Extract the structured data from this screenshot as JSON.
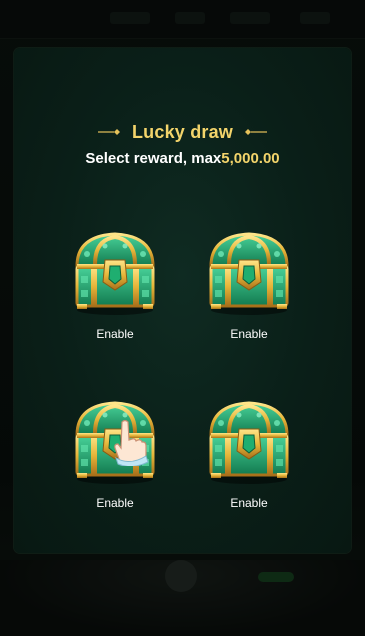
{
  "dialog": {
    "title": "Lucky draw",
    "subtitle_prefix": "Select reward, max",
    "max_amount": "5,000.00"
  },
  "chests": [
    {
      "label": "Enable"
    },
    {
      "label": "Enable"
    },
    {
      "label": "Enable"
    },
    {
      "label": "Enable"
    }
  ],
  "colors": {
    "gold_text": "#f3d46b",
    "panel_bg": "#0a1f18",
    "chest_gold": "#e6b63a",
    "chest_gem": "#1f9e6a"
  },
  "icons": {
    "title_decoration": "ornament-icon",
    "chest": "treasure-chest-icon",
    "pointer": "pointing-hand-icon"
  }
}
